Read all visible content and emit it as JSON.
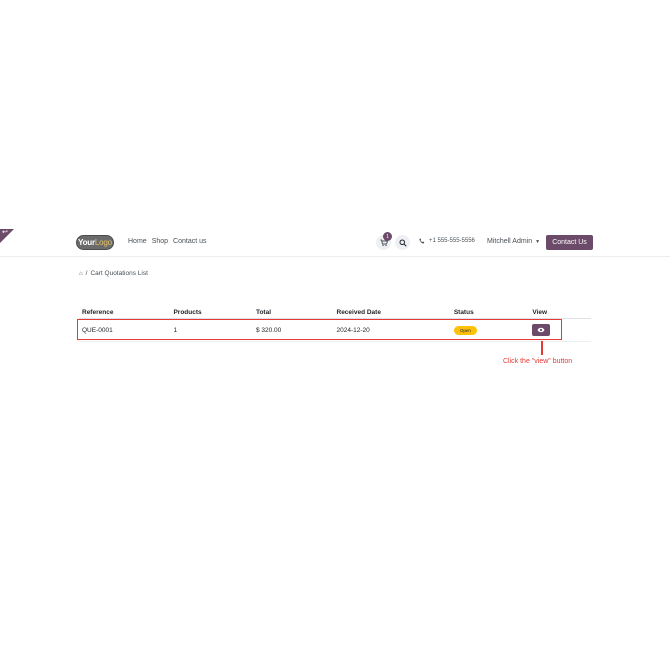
{
  "navbar": {
    "logo_text_a": "Your",
    "logo_text_b": "Logo",
    "links": [
      "Home",
      "Shop",
      "Contact us"
    ],
    "cart_count": "1",
    "phone": "+1 555-555-5556",
    "user": "Mitchell Admin",
    "contact_button": "Contact Us"
  },
  "breadcrumb": {
    "separator": "/",
    "current": "Cart Quotations List"
  },
  "table": {
    "headers": [
      "Reference",
      "Products",
      "Total",
      "Received Date",
      "Status",
      "View"
    ],
    "rows": [
      {
        "reference": "QUE-0001",
        "products": "1",
        "total": "$ 320.00",
        "received_date": "2024-12-20",
        "status": "Open"
      }
    ]
  },
  "annotation": "Click the \"view\" button",
  "colors": {
    "brand": "#6c4a6a",
    "status_open": "#ffc107",
    "annotation": "#e53935"
  }
}
